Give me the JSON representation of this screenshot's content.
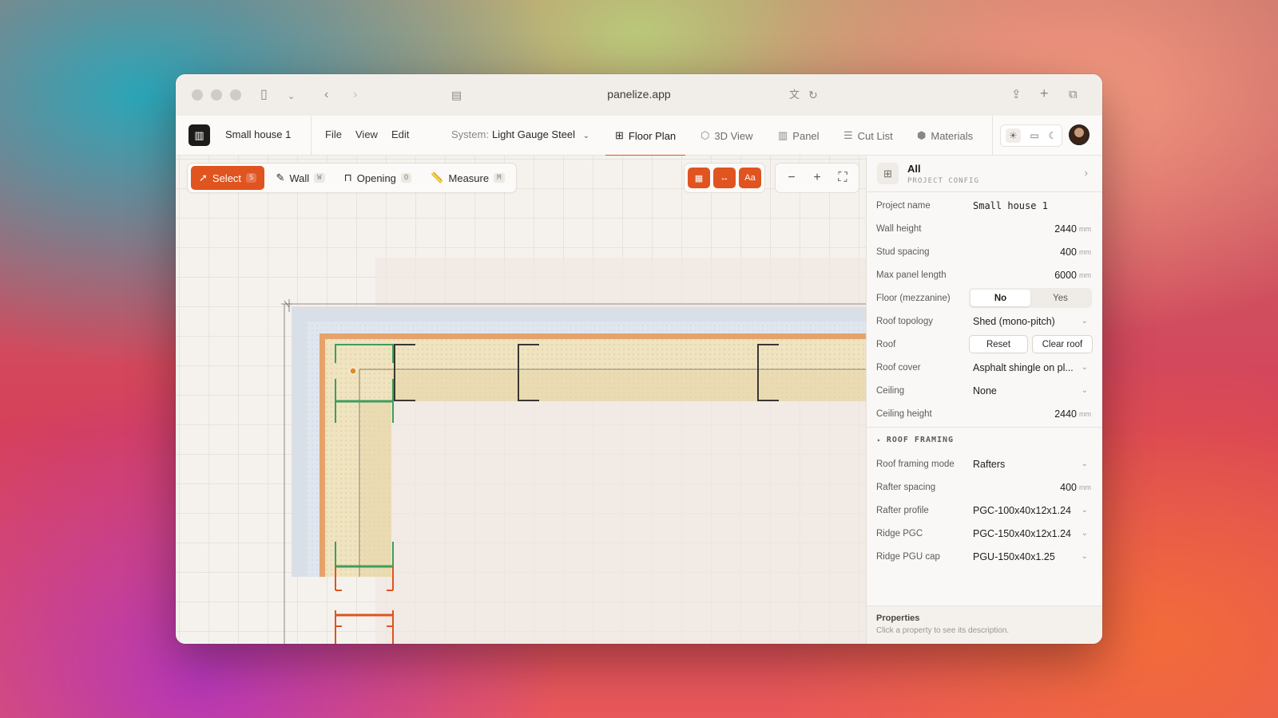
{
  "browser": {
    "url": "panelize.app"
  },
  "header": {
    "project_title": "Small house 1",
    "menus": [
      "File",
      "View",
      "Edit"
    ],
    "system_label": "System:",
    "system_value": "Light Gauge Steel",
    "tabs": [
      {
        "label": "Floor Plan",
        "icon": "floor-plan-icon",
        "active": true
      },
      {
        "label": "3D View",
        "icon": "cube-icon",
        "active": false
      },
      {
        "label": "Panel",
        "icon": "panel-icon",
        "active": false
      },
      {
        "label": "Cut List",
        "icon": "list-icon",
        "active": false
      },
      {
        "label": "Materials",
        "icon": "materials-icon",
        "active": false
      }
    ],
    "accent_color": "#e0541f"
  },
  "toolbar": {
    "tools": [
      {
        "label": "Select",
        "shortcut": "S",
        "active": true
      },
      {
        "label": "Wall",
        "shortcut": "W",
        "active": false
      },
      {
        "label": "Opening",
        "shortcut": "O",
        "active": false
      },
      {
        "label": "Measure",
        "shortcut": "M",
        "active": false
      }
    ],
    "view_toggles": [
      "grid-icon",
      "dimensions-icon",
      "labels-icon"
    ],
    "labels_toggle_text": "Aa"
  },
  "panel": {
    "title": "All",
    "subtitle": "PROJECT CONFIG",
    "rows": {
      "project_name": {
        "label": "Project name",
        "value": "Small house 1"
      },
      "wall_height": {
        "label": "Wall height",
        "value": "2440",
        "unit": "mm"
      },
      "stud_spacing": {
        "label": "Stud spacing",
        "value": "400",
        "unit": "mm"
      },
      "max_panel_length": {
        "label": "Max panel length",
        "value": "6000",
        "unit": "mm"
      },
      "floor_mezzanine": {
        "label": "Floor (mezzanine)",
        "options": [
          "No",
          "Yes"
        ],
        "selected": "No"
      },
      "roof_topology": {
        "label": "Roof topology",
        "value": "Shed (mono-pitch)"
      },
      "roof": {
        "label": "Roof",
        "reset_label": "Reset",
        "clear_label": "Clear roof"
      },
      "roof_cover": {
        "label": "Roof cover",
        "value": "Asphalt shingle on pl..."
      },
      "ceiling": {
        "label": "Ceiling",
        "value": "None"
      },
      "ceiling_height": {
        "label": "Ceiling height",
        "value": "2440",
        "unit": "mm"
      }
    },
    "roof_framing_section": "ROOF FRAMING",
    "framing_rows": {
      "roof_framing_mode": {
        "label": "Roof framing mode",
        "value": "Rafters"
      },
      "rafter_spacing": {
        "label": "Rafter spacing",
        "value": "400",
        "unit": "mm"
      },
      "rafter_profile": {
        "label": "Rafter profile",
        "value": "PGC-100x40x12x1.24"
      },
      "ridge_pgc": {
        "label": "Ridge PGC",
        "value": "PGC-150x40x12x1.24"
      },
      "ridge_pgu_cap": {
        "label": "Ridge PGU cap",
        "value": "PGU-150x40x1.25"
      }
    },
    "footer_title": "Properties",
    "footer_text": "Click a property to see its description."
  }
}
